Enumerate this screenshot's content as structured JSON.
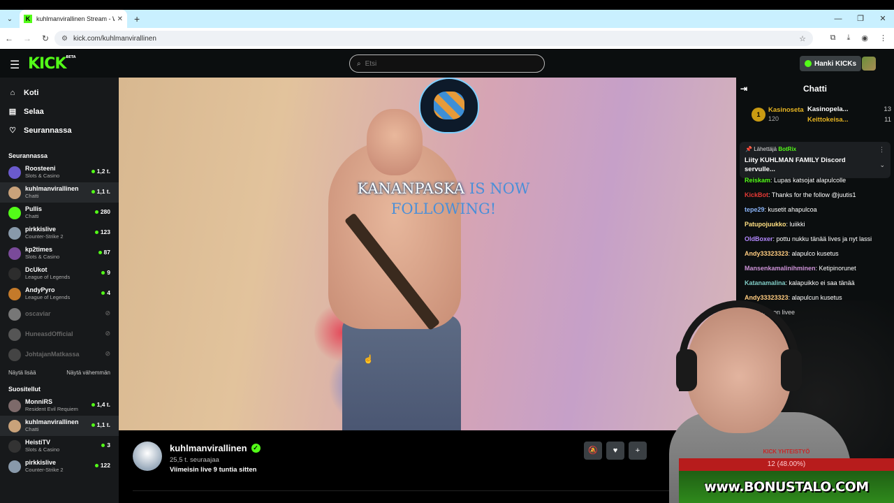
{
  "browser": {
    "tab_title": "kuhlmanvirallinen Stream - Wat",
    "url": "kick.com/kuhlmanvirallinen"
  },
  "header": {
    "logo": "KICK",
    "logo_beta": "BETA",
    "search_placeholder": "Etsi",
    "kicks_button": "Hanki KICKs"
  },
  "sidebar": {
    "nav": [
      {
        "label": "Koti",
        "icon": "home-icon"
      },
      {
        "label": "Selaa",
        "icon": "browse-icon"
      },
      {
        "label": "Seurannassa",
        "icon": "heart-icon"
      }
    ],
    "following_title": "Seurannassa",
    "following": [
      {
        "name": "Roosteeni",
        "category": "Slots & Casino",
        "viewers": "1,2 t.",
        "color": "#6a5acd"
      },
      {
        "name": "kuhlmanvirallinen",
        "category": "Chatti",
        "viewers": "1,1 t.",
        "color": "#c9a27a"
      },
      {
        "name": "Pullis",
        "category": "Chatti",
        "viewers": "280",
        "color": "#53fc18"
      },
      {
        "name": "pirkkislive",
        "category": "Counter-Strike 2",
        "viewers": "123",
        "color": "#8899aa"
      },
      {
        "name": "kp2times",
        "category": "Slots & Casino",
        "viewers": "87",
        "color": "#7a4a9a"
      },
      {
        "name": "DcUkot",
        "category": "League of Legends",
        "viewers": "9",
        "color": "#2d2d2d"
      },
      {
        "name": "AndyPyro",
        "category": "League of Legends",
        "viewers": "4",
        "color": "#c47a2a"
      }
    ],
    "offline": [
      {
        "name": "oscaviar",
        "color": "#777"
      },
      {
        "name": "HuneasdOfficial",
        "color": "#555"
      },
      {
        "name": "JohtajanMatkassa",
        "color": "#444"
      }
    ],
    "show_more": "Näytä lisää",
    "show_less": "Näytä vähemmän",
    "recommended_title": "Suositellut",
    "recommended": [
      {
        "name": "MonniRS",
        "category": "Resident Evil Requiem",
        "viewers": "1,4 t.",
        "color": "#7d6a6a"
      },
      {
        "name": "kuhlmanvirallinen",
        "category": "Chatti",
        "viewers": "1,1 t.",
        "color": "#c9a27a"
      },
      {
        "name": "HeistiTV",
        "category": "Slots & Casino",
        "viewers": "3",
        "color": "#333"
      },
      {
        "name": "pirkkislive",
        "category": "Counter-Strike 2",
        "viewers": "122",
        "color": "#8899aa"
      }
    ]
  },
  "video": {
    "alert_name": "KANANPASKA",
    "alert_text": "IS NOW",
    "alert_text2": "FOLLOWING!"
  },
  "channel": {
    "name": "kuhlmanvirallinen",
    "followers": "25,5 t. seuraajaa",
    "last_live": "Viimeisin live 9 tuntia sitten"
  },
  "chat": {
    "title": "Chatti",
    "leaderboard": {
      "rank": "1",
      "first_name": "Kasinoseta",
      "first_score": "120",
      "rows": [
        {
          "name": "Kasinopela...",
          "score": "13"
        },
        {
          "name": "Keittokeisa...",
          "score": "11"
        }
      ]
    },
    "pinned": {
      "by_label": "Lähettäjä",
      "by_user": "BotRix",
      "message": "Liity KUHLMAN FAMILY Discord servulle..."
    },
    "messages": [
      {
        "user": "Reiskam",
        "text": "Lupas katsojat alapulcolle",
        "color": "#53fc18"
      },
      {
        "user": "KickBot",
        "text": "Thanks for the follow @juutis1",
        "color": "#e53935"
      },
      {
        "user": "tepe29",
        "text": "kusetit ahapulcoa",
        "color": "#8ab4f8"
      },
      {
        "user": "Patupojuukko",
        "text": "luiikki",
        "color": "#ffe082"
      },
      {
        "user": "OldBoxer",
        "text": "pottu nukku tänää lives ja nyt lassi",
        "color": "#b388ff"
      },
      {
        "user": "Andy33323323",
        "text": "alapulco kusetus",
        "color": "#ffcc80"
      },
      {
        "user": "Mansenkamalinihminen",
        "text": "Ketipinorunet",
        "color": "#ce93d8"
      },
      {
        "user": "Katanamalina",
        "text": "kalapuikko ei saa tänää",
        "color": "#80cbc4"
      },
      {
        "user": "Andy33323323",
        "text": "alapulcun kusetus",
        "color": "#ffcc80"
      },
      {
        "user": "",
        "text": "luiikki pulcon livee",
        "color": "#fff"
      }
    ]
  },
  "overlay": {
    "promo_label": "KICK YHTEISTYÖ",
    "promo_progress": "12 (48.00%)",
    "promo_site": "www.BONUSTALO.COM"
  }
}
